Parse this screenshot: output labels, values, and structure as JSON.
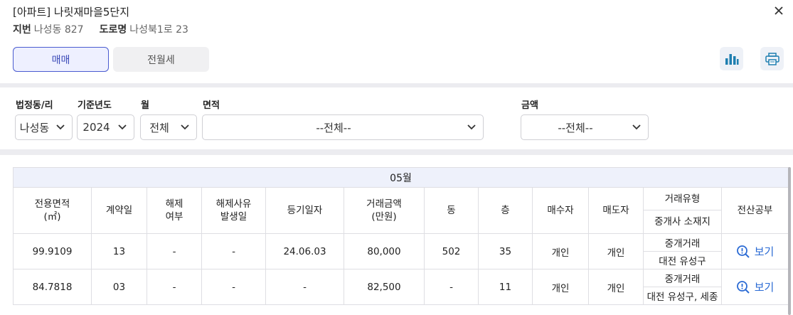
{
  "header": {
    "title": "[아파트] 나릿재마을5단지",
    "lot_label": "지번",
    "lot_value": "나성동 827",
    "road_label": "도로명",
    "road_value": "나성북1로 23"
  },
  "tabs": [
    {
      "label": "매매",
      "active": true
    },
    {
      "label": "전월세",
      "active": false
    }
  ],
  "icons": {
    "chart": "bar-chart-icon",
    "print": "printer-icon",
    "close": "close-icon"
  },
  "filters": {
    "dong": {
      "label": "법정동/리",
      "value": "나성동"
    },
    "year": {
      "label": "기준년도",
      "value": "2024"
    },
    "month": {
      "label": "월",
      "value": "전체"
    },
    "area": {
      "label": "면적",
      "value": "--전체--"
    },
    "price": {
      "label": "금액",
      "value": "--전체--"
    }
  },
  "table": {
    "month_header": "05월",
    "columns": {
      "area": "전용면적\n(㎡)",
      "contract_day": "계약일",
      "cancel": "해제\n여부",
      "cancel_date": "해제사유\n발생일",
      "reg_date": "등기일자",
      "price": "거래금액\n(만원)",
      "dong": "동",
      "floor": "층",
      "buyer": "매수자",
      "seller": "매도자",
      "deal_type": "거래유형",
      "agent_loc": "중개사 소재지",
      "registry": "전산공부"
    },
    "rows": [
      {
        "area": "99.9109",
        "contract_day": "13",
        "cancel": "-",
        "cancel_date": "-",
        "reg_date": "24.06.03",
        "price": "80,000",
        "dong": "502",
        "floor": "35",
        "buyer": "개인",
        "seller": "개인",
        "deal_type": "중개거래",
        "agent_loc": "대전 유성구",
        "view": "보기"
      },
      {
        "area": "84.7818",
        "contract_day": "03",
        "cancel": "-",
        "cancel_date": "-",
        "reg_date": "-",
        "price": "82,500",
        "dong": "-",
        "floor": "11",
        "buyer": "개인",
        "seller": "개인",
        "deal_type": "중개거래",
        "agent_loc": "대전 유성구, 세종",
        "view": "보기"
      }
    ]
  },
  "colors": {
    "accent": "#4a5bd0",
    "link": "#2a6ad4",
    "month_bg": "#eef1fb"
  }
}
